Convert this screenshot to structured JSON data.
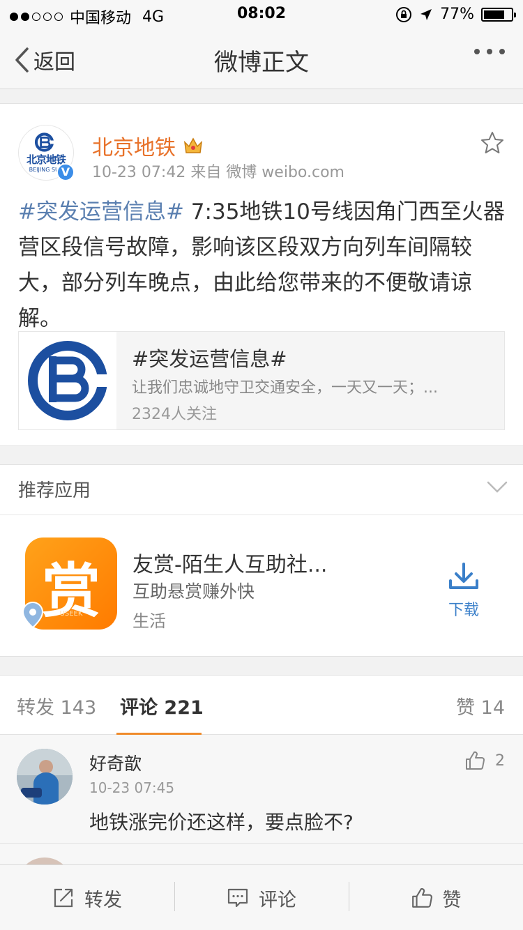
{
  "status_bar": {
    "carrier": "中国移动",
    "network": "4G",
    "time": "08:02",
    "battery": "77%",
    "battery_level": 0.77,
    "signal_bars_filled": 2,
    "signal_bars_total": 5
  },
  "nav": {
    "back_label": "返回",
    "title": "微博正文"
  },
  "post": {
    "author": "北京地铁",
    "avatar_text": "北京地铁",
    "avatar_subtext": "BEIJING SUB",
    "verified_mark": "V",
    "meta": "10-23 07:42  来自 微博 weibo.com",
    "hashtag": "#突发运营信息#",
    "body": " 7:35地铁10号线因角门西至火器营区段信号故障，影响该区段双方向列车间隔较大，部分列车晚点，由此给您带来的不便敬请谅解。",
    "topic": {
      "title": "#突发运营信息#",
      "description": "让我们忠诚地守卫交通安全，一天又一天；...",
      "followers": "2324人关注"
    }
  },
  "recommend": {
    "header": "推荐应用",
    "app": {
      "icon_char": "赏",
      "icon_sub": "USEEK",
      "name": "友赏-陌生人互助社...",
      "description": "互助悬赏赚外快",
      "category": "生活",
      "download_label": "下载"
    }
  },
  "tabs": {
    "repost_label": "转发",
    "repost_count": "143",
    "comment_label": "评论",
    "comment_count": "221",
    "like_label": "赞",
    "like_count": "14"
  },
  "comments": [
    {
      "name": "好奇歆",
      "time": "10-23 07:45",
      "text": "地铁涨完价还这样，要点脸不?",
      "likes": "2"
    }
  ],
  "toolbar": {
    "repost": "转发",
    "comment": "评论",
    "like": "赞"
  },
  "colors": {
    "author_orange": "#e8722a",
    "hashtag_blue": "#5a7fb0",
    "tab_accent": "#f08b2b",
    "metro_blue": "#1c4fa0",
    "download_blue": "#3a7fc9"
  }
}
